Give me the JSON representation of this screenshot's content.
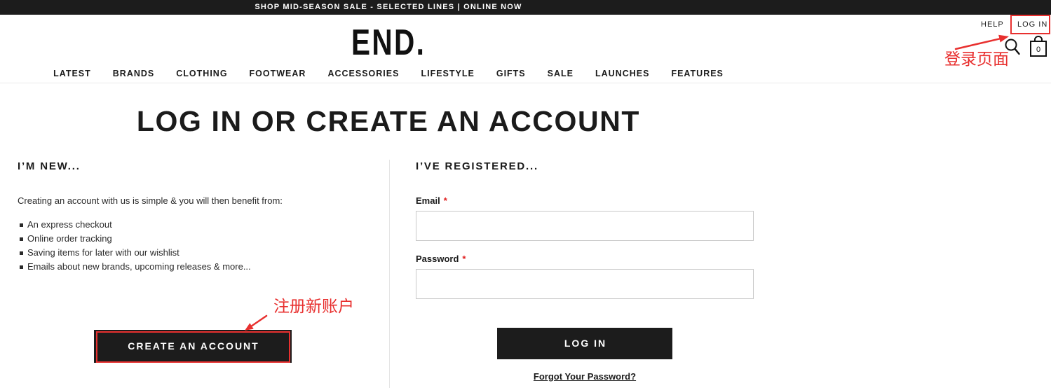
{
  "banner": {
    "text": "SHOP MID-SEASON SALE - SELECTED LINES | ONLINE NOW"
  },
  "header": {
    "logo": "END.",
    "utility": {
      "help": "HELP",
      "login": "LOG IN"
    },
    "icons": {
      "search": "search-icon",
      "bag": "shopping-bag-icon",
      "bullet": "square-bullet-icon"
    },
    "bag_count": "0",
    "nav": [
      "LATEST",
      "BRANDS",
      "CLOTHING",
      "FOOTWEAR",
      "ACCESSORIES",
      "LIFESTYLE",
      "GIFTS",
      "SALE",
      "LAUNCHES",
      "FEATURES"
    ]
  },
  "page": {
    "title": "LOG IN OR CREATE AN ACCOUNT",
    "new_customer": {
      "heading": "I’M NEW...",
      "intro": "Creating an account with us is simple & you will then benefit from:",
      "benefits": [
        "An express checkout",
        "Online order tracking",
        "Saving items for later with our wishlist",
        "Emails about new brands, upcoming releases & more..."
      ],
      "button": "CREATE AN ACCOUNT"
    },
    "registered": {
      "heading": "I’VE REGISTERED...",
      "email": {
        "label": "Email",
        "required": "*",
        "value": ""
      },
      "password": {
        "label": "Password",
        "required": "*",
        "value": ""
      },
      "button": "LOG IN",
      "forgot_link": "Forgot Your Password?"
    }
  },
  "annotations": {
    "login_page": "登录页面",
    "register_new_account": "注册新账户"
  },
  "colors": {
    "banner_black": "#1c1c1c",
    "button_black": "#1c1c1c",
    "text_dark": "#1b1b1b",
    "required_red": "#e02020",
    "annotation_red": "#e8302f"
  }
}
